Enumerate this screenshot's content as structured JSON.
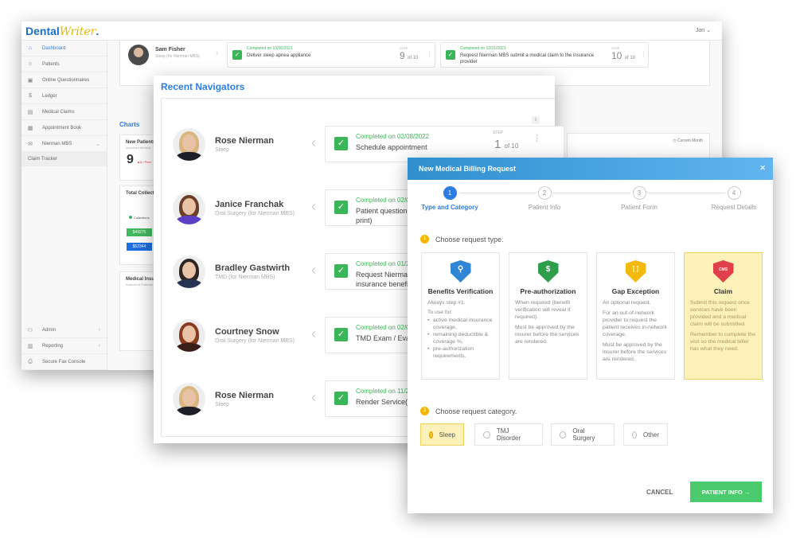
{
  "app": {
    "logo_part1": "Dental",
    "logo_part2": "Writer",
    "logo_dot": ".",
    "user_menu": "Jon ⌄"
  },
  "sidebar": {
    "items": [
      {
        "label": "Dashboard",
        "icon": "home-icon",
        "glyph": "⌂"
      },
      {
        "label": "Patients",
        "icon": "tooth-icon",
        "glyph": "☺"
      },
      {
        "label": "Online Questionnaires",
        "icon": "clipboard-icon",
        "glyph": "▣"
      },
      {
        "label": "Ledger",
        "icon": "dollar-icon",
        "glyph": "$"
      },
      {
        "label": "Medical Claims",
        "icon": "document-icon",
        "glyph": "▤"
      },
      {
        "label": "Appointment Book",
        "icon": "calendar-icon",
        "glyph": "▦"
      },
      {
        "label": "Nierman MBS",
        "icon": "mail-icon",
        "glyph": "✉",
        "chevron": "⌄"
      }
    ],
    "sub_item": "Claim Tracker",
    "bottom_items": [
      {
        "label": "Admin",
        "icon": "user-admin-icon",
        "glyph": "⚇",
        "chevron": "›"
      },
      {
        "label": "Reporting",
        "icon": "report-icon",
        "glyph": "▥",
        "chevron": "›"
      },
      {
        "label": "Secure Fax Console",
        "icon": "fax-icon",
        "glyph": "⎙"
      }
    ]
  },
  "dashboard": {
    "top_navigator": {
      "name": "Sam Fisher",
      "subtitle": "Sleep (for Nierman MBS)",
      "cards": [
        {
          "completed": "Completed on 10/06/2021",
          "task": "Deliver sleep apnea appliance",
          "step_label": "STEP",
          "step": "9",
          "of": "of 10"
        },
        {
          "completed": "Completed on 10/21/2021",
          "task": "Request Nierman MBS submit a medical claim to the insurance provider",
          "step_label": "STEP",
          "step": "10",
          "of": "of 10"
        }
      ]
    },
    "charts_title": "Charts",
    "new_patients": {
      "title": "New Patients",
      "subtitle": "Important Metrics",
      "value": "9",
      "delta": "▲6 / Prev"
    },
    "total_collections": {
      "title": "Total Collections",
      "legend": "Collections",
      "values": [
        "$49275",
        "$52344"
      ]
    },
    "medical_insurance": {
      "title": "Medical Insurance",
      "subtitle": "Amount of Patients"
    },
    "current_month": "Current Month"
  },
  "navigators": {
    "title": "Recent Navigators",
    "info": "i",
    "rows": [
      {
        "name": "Rose Nierman",
        "subtitle": "Sleep",
        "completed": "Completed on 02/08/2022",
        "task": "Schedule appointment",
        "step_label": "STEP",
        "step": "1",
        "of": "of 10",
        "hair": "#d9b680",
        "body": "#1e1e2a"
      },
      {
        "name": "Janice Franchak",
        "subtitle": "Oral Surgery (for Nierman MBS)",
        "completed": "Completed on 02/0",
        "task": "Patient questionn print)",
        "hair": "#6b3f2a",
        "body": "#5b3fc4"
      },
      {
        "name": "Bradley Gastwirth",
        "subtitle": "TMD (for Nierman MBS)",
        "completed": "Completed on 01/2",
        "task": "Request Niermar insurance benefi",
        "hair": "#2e2520",
        "body": "#263352"
      },
      {
        "name": "Courtney Snow",
        "subtitle": "Oral Surgery (for Nierman MBS)",
        "completed": "Completed on 02/0",
        "task": "TMD Exam / Eva",
        "hair": "#8a3a1e",
        "body": "#3a1f18"
      },
      {
        "name": "Rose Nierman",
        "subtitle": "Sleep",
        "completed": "Completed on 11/2",
        "task": "Render Service(s",
        "hair": "#d9b680",
        "body": "#1e1e2a"
      }
    ]
  },
  "modal": {
    "title": "New Medical Billing Request",
    "close": "×",
    "steps": [
      {
        "num": "1",
        "label": "Type and Category",
        "active": true
      },
      {
        "num": "2",
        "label": "Patient Info"
      },
      {
        "num": "3",
        "label": "Patient Form"
      },
      {
        "num": "4",
        "label": "Request Details"
      }
    ],
    "section1": {
      "num": "1",
      "label": "Choose request type."
    },
    "types": [
      {
        "title": "Benefits Verification",
        "icon": "search-shield-icon",
        "glyph": "⚲",
        "color": "#2f86d6",
        "p1": "Always step #1.",
        "p2": "To use for:",
        "bullets": [
          "active medical insurance coverage,",
          "remaining deductible & coverage %,",
          "pre-authorization requirements."
        ]
      },
      {
        "title": "Pre-authorization",
        "icon": "dollar-shield-icon",
        "glyph": "$",
        "color": "#2e9e4a",
        "p1": "When required (benefit verification will reveal if required).",
        "p2": "Must be approved by the insurer before the services are rendered."
      },
      {
        "title": "Gap Exception",
        "icon": "bracket-shield-icon",
        "glyph": "[ ]",
        "color": "#f2b90f",
        "p1": "An optional request.",
        "p2": "For an out-of-network provider to request the patient receives in-network coverage.",
        "p3": "Must be approved by the insurer before the services are rendered."
      },
      {
        "title": "Claim",
        "icon": "claim-shield-icon",
        "glyph": "CMS",
        "color": "#e0404a",
        "selected": true,
        "p1": "Submit this request once services have been provided and a medical claim will be submitted.",
        "p2": "Remember to complete the visit so the medical biller has what they need."
      }
    ],
    "section2": {
      "num": "2",
      "label": "Choose request category."
    },
    "categories": [
      {
        "label": "Sleep",
        "selected": true
      },
      {
        "label": "TMJ Disorder"
      },
      {
        "label": "Oral Surgery"
      },
      {
        "label": "Other"
      }
    ],
    "cancel": "CANCEL",
    "next": "PATIENT INFO  →"
  }
}
